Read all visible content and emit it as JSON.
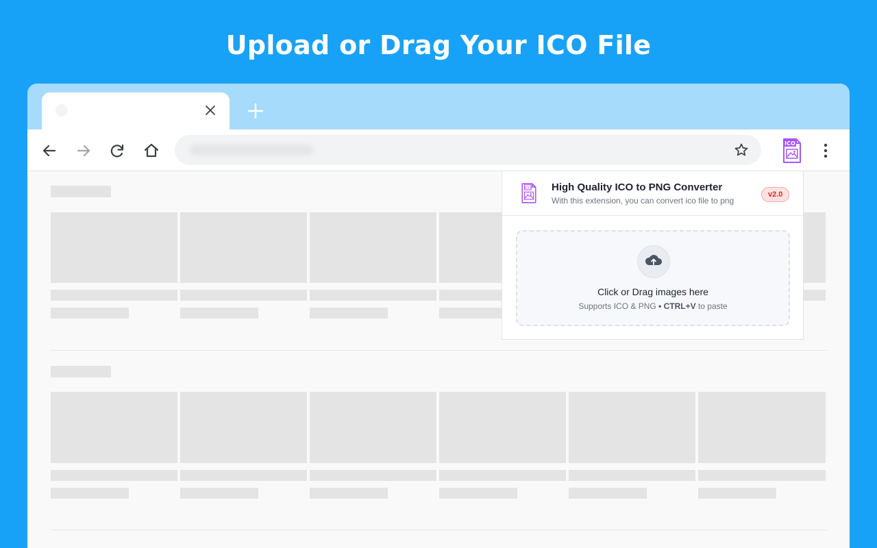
{
  "headline": "Upload or Drag Your ICO File",
  "browser": {
    "tab": {
      "close_icon": "close-icon"
    },
    "toolbar": {
      "back_icon": "arrow-left-icon",
      "forward_icon": "arrow-right-icon",
      "reload_icon": "reload-icon",
      "home_icon": "home-icon",
      "bookmark_icon": "star-icon",
      "extension_icon": "ico-file-icon",
      "menu_icon": "kebab-menu-icon"
    }
  },
  "popup": {
    "title": "High Quality ICO to PNG Converter",
    "description": "With this extension, you can convert ico file to png",
    "version": "v2.0",
    "dropzone": {
      "title": "Click or Drag images here",
      "sub_prefix": "Supports ICO & PNG",
      "sub_separator": "•",
      "shortcut": "CTRL+V",
      "sub_suffix": "to paste"
    }
  },
  "colors": {
    "background": "#18a2f7",
    "tabstrip": "#a6dbfc",
    "accent_purple": "#a855f7",
    "badge_red": "#dc2626"
  }
}
